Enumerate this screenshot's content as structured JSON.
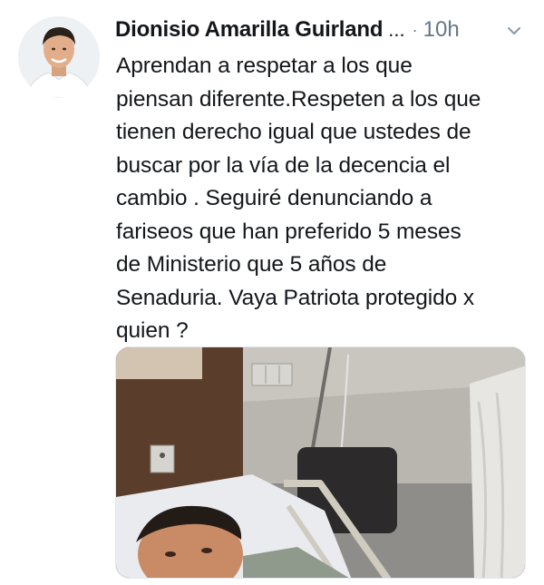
{
  "tweet": {
    "author_name": "Dionisio Amarilla Guirland",
    "truncation": "...",
    "separator": "·",
    "timestamp": "10h",
    "text": "Aprendan a respetar a los que\npiensan diferente.Respeten a los que\ntienen derecho igual que ustedes de\nbuscar por la vía de la decencia el\ncambio . Seguiré denunciando a\nfariseos que han preferido 5 meses\nde Ministerio que 5 años de\nSenaduria. Vaya Patriota protegido x\nquien  ?",
    "menu_icon": "chevron-down-icon",
    "avatar_icon": "profile-photo",
    "media_icon": "photo-hospital-selfie"
  },
  "colors": {
    "text_primary": "#14171a",
    "text_secondary": "#657786",
    "background": "#ffffff",
    "border": "#e1e8ed"
  }
}
